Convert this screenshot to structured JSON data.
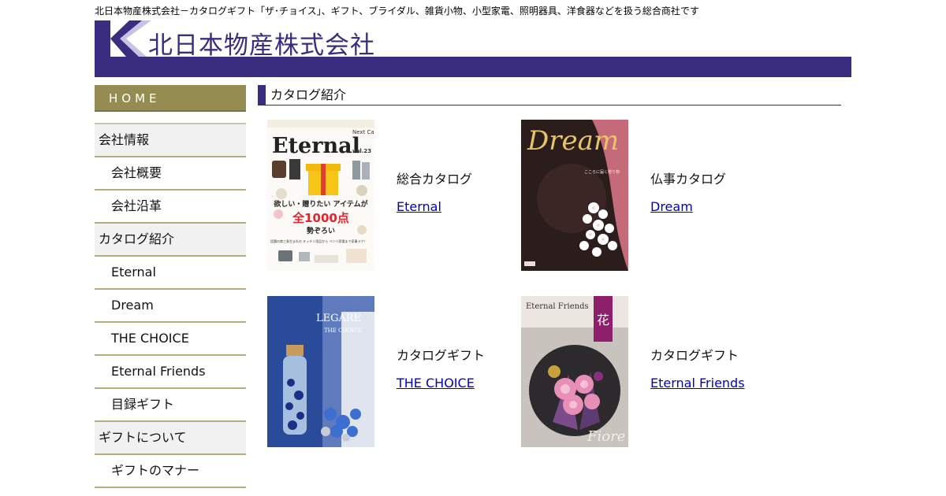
{
  "tagline": "北日本物産株式会社－カタログギフト「ザ･チョイス」、ギフト、ブライダル、雑貨小物、小型家電、照明器具、洋食器などを扱う総合商社です",
  "header": {
    "company_name": "北日本物産株式会社",
    "logo_letter": "K"
  },
  "sidebar": {
    "home": "HOME",
    "items": [
      {
        "label": "会社情報",
        "type": "cat"
      },
      {
        "label": "会社概要",
        "type": "sub"
      },
      {
        "label": "会社沿革",
        "type": "sub"
      },
      {
        "label": "カタログ紹介",
        "type": "cat"
      },
      {
        "label": "Eternal",
        "type": "sub"
      },
      {
        "label": "Dream",
        "type": "sub"
      },
      {
        "label": "THE CHOICE",
        "type": "sub"
      },
      {
        "label": "Eternal Friends",
        "type": "sub"
      },
      {
        "label": "目録ギフト",
        "type": "sub"
      },
      {
        "label": "ギフトについて",
        "type": "cat"
      },
      {
        "label": "ギフトのマナー",
        "type": "sub"
      }
    ]
  },
  "main": {
    "title": "カタログ紹介",
    "catalogs": [
      {
        "label": "総合カタログ",
        "link": "Eternal",
        "cover": {
          "title": "Eternal",
          "side": "Next Catalogue",
          "vol": "vol.23",
          "headline": "欲しい・贈りたい アイテムが",
          "count": "全1000点",
          "sub": "勢ぞろい",
          "footer": "話題の商三条生まれの キッチン用品から ベンリ家電まで家事ラク！"
        }
      },
      {
        "label": "仏事カタログ",
        "link": "Dream",
        "cover": {
          "title": "Dream",
          "side": "こころに届く贈り物"
        }
      },
      {
        "label": "カタログギフト",
        "link": "THE CHOICE",
        "cover": {
          "title": "LEGARE",
          "sub": "THE CHOICE"
        }
      },
      {
        "label": "カタログギフト",
        "link": "Eternal Friends",
        "cover": {
          "title": "Eternal Friends",
          "badge": "花",
          "script": "Fiore"
        }
      }
    ]
  },
  "colors": {
    "brand": "#3a2d80",
    "home": "#958c52",
    "nav_border": "#b6ad7a",
    "link": "#0000cc"
  }
}
